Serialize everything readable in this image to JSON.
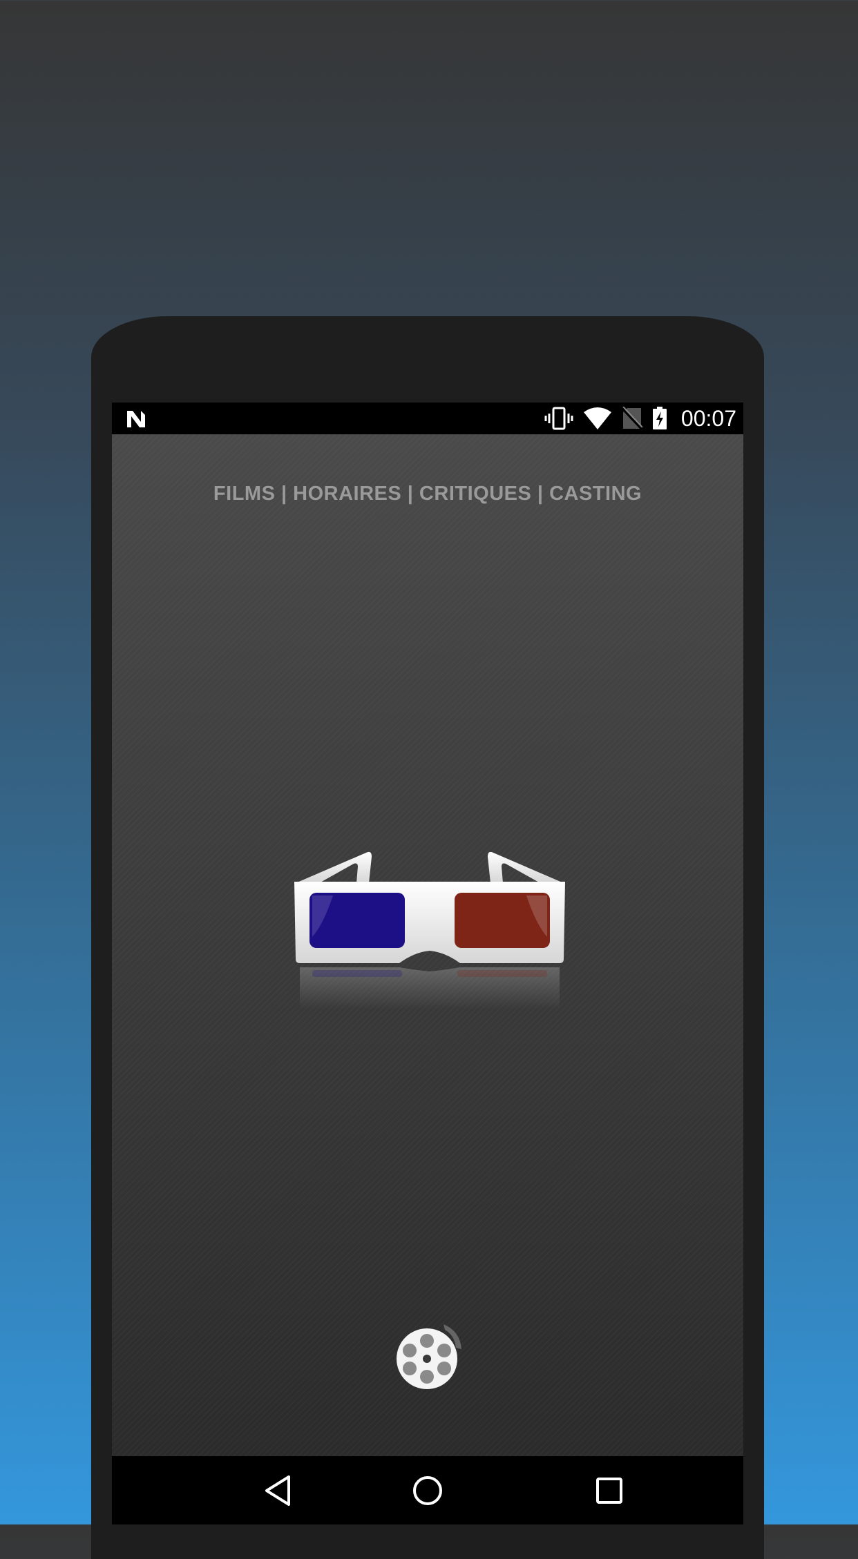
{
  "status_bar": {
    "time": "00:07",
    "icons": [
      "notification-n-icon",
      "vibrate-icon",
      "wifi-icon",
      "no-sim-icon",
      "battery-icon"
    ]
  },
  "splash": {
    "tagline": "FILMS | HORAIRES | CRITIQUES | CASTING",
    "logo": "3d-glasses-icon",
    "loader": "film-reel-icon"
  },
  "nav_bar": {
    "buttons": [
      "back-icon",
      "home-icon",
      "recents-icon"
    ]
  },
  "colors": {
    "lens_left": "#1d0f86",
    "lens_right": "#7e2517",
    "frame": "#f2f2f2"
  }
}
